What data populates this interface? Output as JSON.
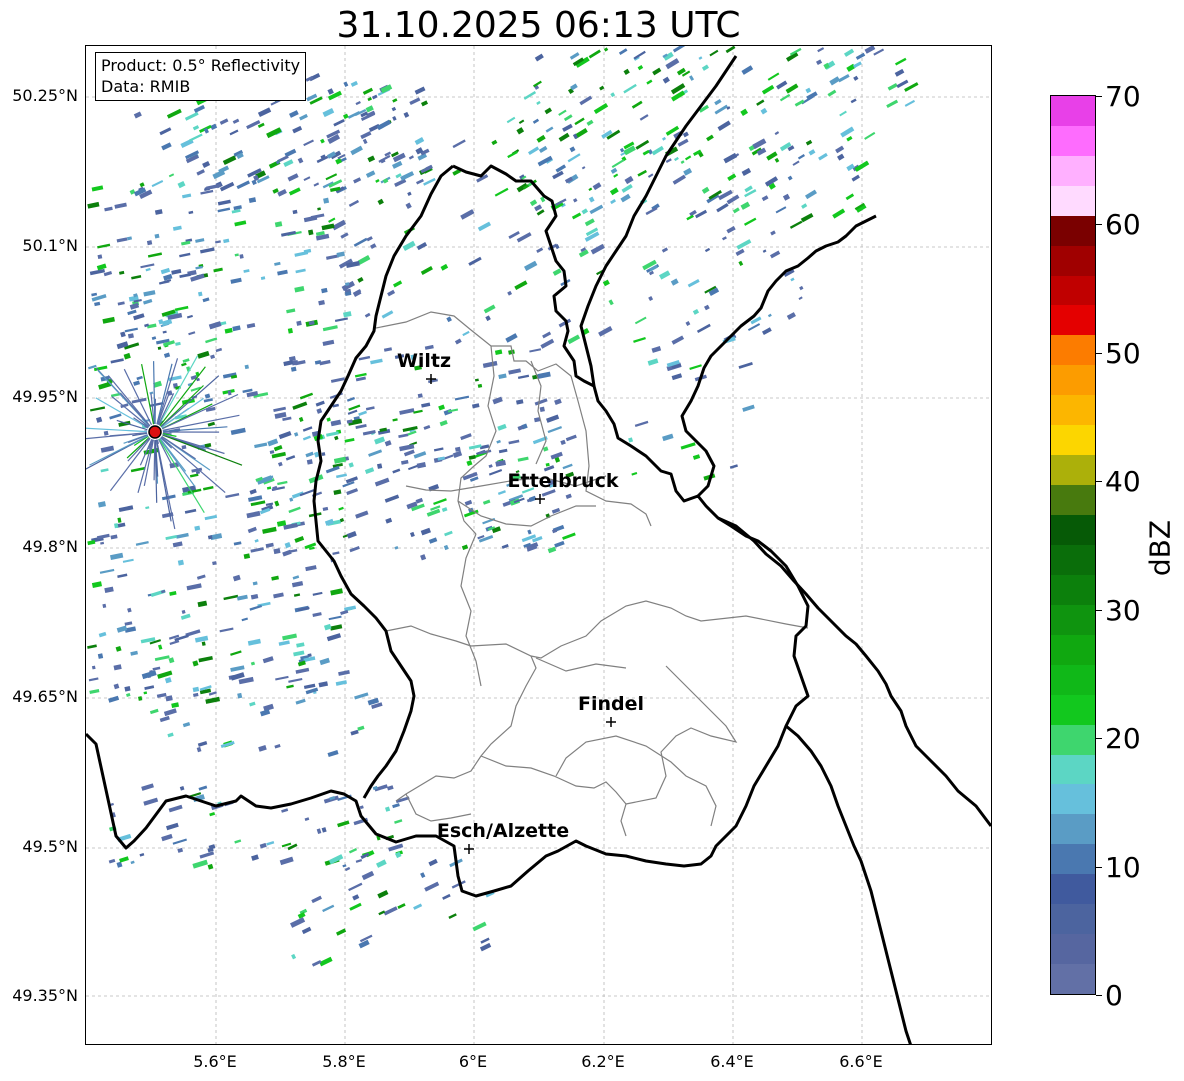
{
  "title": "31.10.2025 06:13 UTC",
  "info": {
    "product": "Product: 0.5° Reflectivity",
    "data_source": "Data: RMIB"
  },
  "axes": {
    "lat_labels": [
      "50.25°N",
      "50.1°N",
      "49.95°N",
      "49.8°N",
      "49.65°N",
      "49.5°N",
      "49.35°N"
    ],
    "lon_labels": [
      "5.6°E",
      "5.8°E",
      "6°E",
      "6.2°E",
      "6.4°E",
      "6.6°E"
    ],
    "gridlines": true
  },
  "cities": [
    {
      "name": "Wiltz"
    },
    {
      "name": "Ettelbruck"
    },
    {
      "name": "Findel"
    },
    {
      "name": "Esch/Alzette"
    }
  ],
  "colorbar": {
    "label": "dBZ",
    "ticks": [
      "0",
      "10",
      "20",
      "30",
      "40",
      "50",
      "60",
      "70"
    ],
    "colors": [
      "#6270a6",
      "#5666a0",
      "#4c649f",
      "#405a9e",
      "#4a78b0",
      "#5a9cc5",
      "#66c0dc",
      "#5cd6c4",
      "#3ed66e",
      "#12c81e",
      "#10b818",
      "#10a810",
      "#0f940f",
      "#0c800c",
      "#0a6e0a",
      "#065a06",
      "#487a0e",
      "#acb00a",
      "#fcd600",
      "#fcb600",
      "#fc9c00",
      "#fc7c00",
      "#e40000",
      "#c00000",
      "#a00000",
      "#7a0000",
      "#ffdaff",
      "#ffb0ff",
      "#fe6cfe",
      "#e840e8"
    ]
  },
  "colors": {
    "radar_marker": "#dd1111",
    "border": "#000000",
    "district_lines": "#808080"
  }
}
